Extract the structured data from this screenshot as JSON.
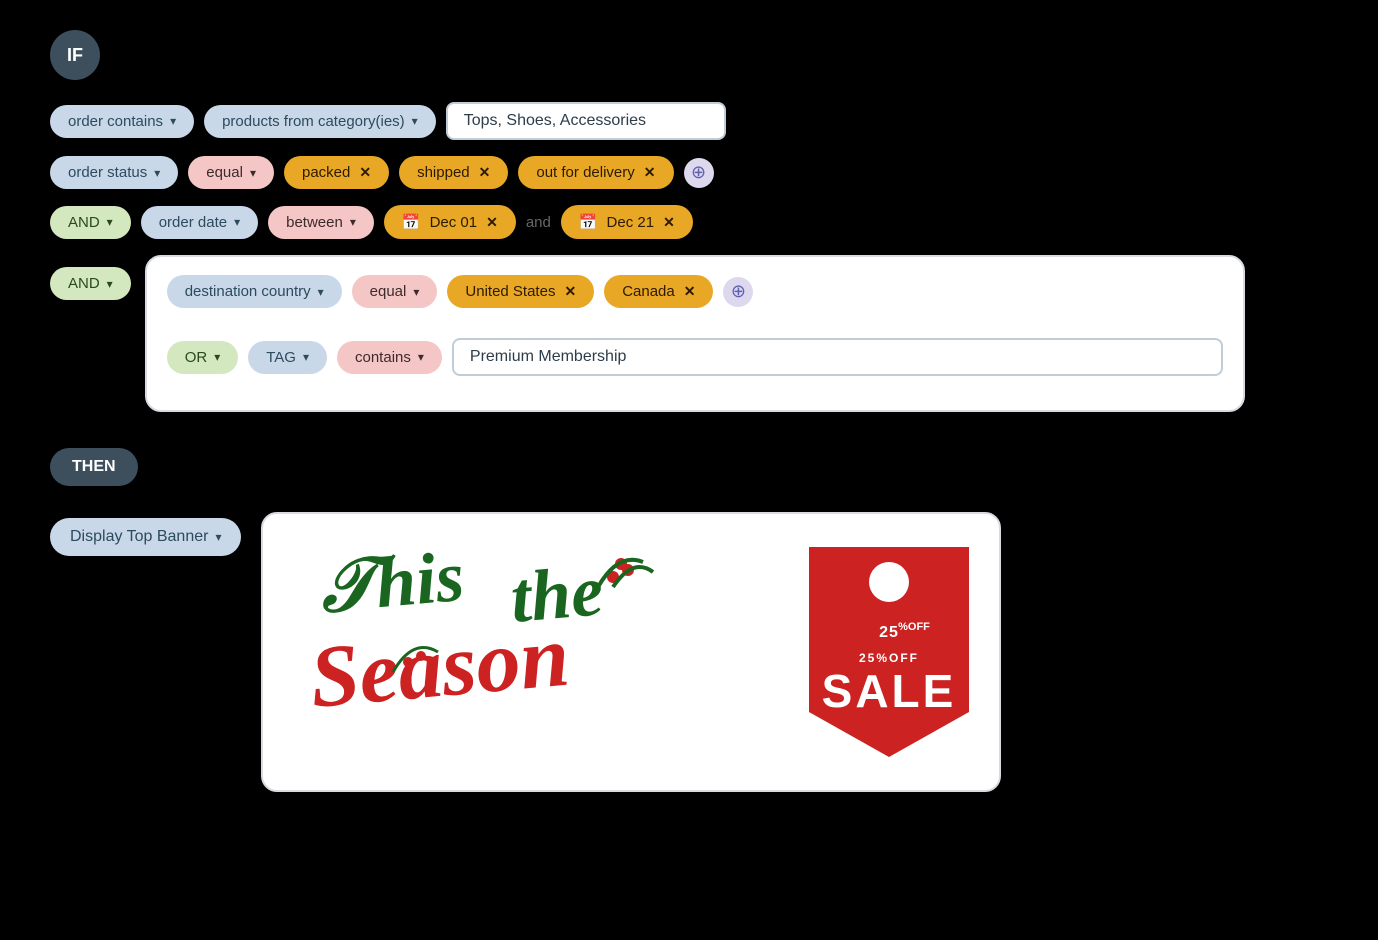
{
  "if_label": "IF",
  "then_label": "THEN",
  "row1": {
    "condition1": "order contains",
    "condition2": "products from category(ies)",
    "input_value": "Tops, Shoes, Accessories"
  },
  "row2": {
    "condition1": "order status",
    "condition2": "equal",
    "tag1": "packed",
    "tag2": "shipped",
    "tag3": "out for delivery"
  },
  "row3": {
    "and_label": "AND",
    "condition1": "order date",
    "condition2": "between",
    "date1": "Dec 01",
    "date2": "Dec 21",
    "and_text": "and"
  },
  "row4": {
    "and_label": "AND",
    "nested": {
      "condition1": "destination country",
      "condition2": "equal",
      "tag1": "United States",
      "tag2": "Canada",
      "or_label": "OR",
      "condition3": "TAG",
      "condition4": "contains",
      "input_value": "Premium Membership"
    }
  },
  "then": {
    "action": "Display Top Banner",
    "banner_alt": "This is the Season 25% OFF SALE Christmas Banner"
  },
  "banner": {
    "line1": "'Tis the",
    "line1_styled": "𝒯his the",
    "line2": "Season",
    "tag_line1": "25%OFF",
    "tag_sale": "SALE"
  }
}
